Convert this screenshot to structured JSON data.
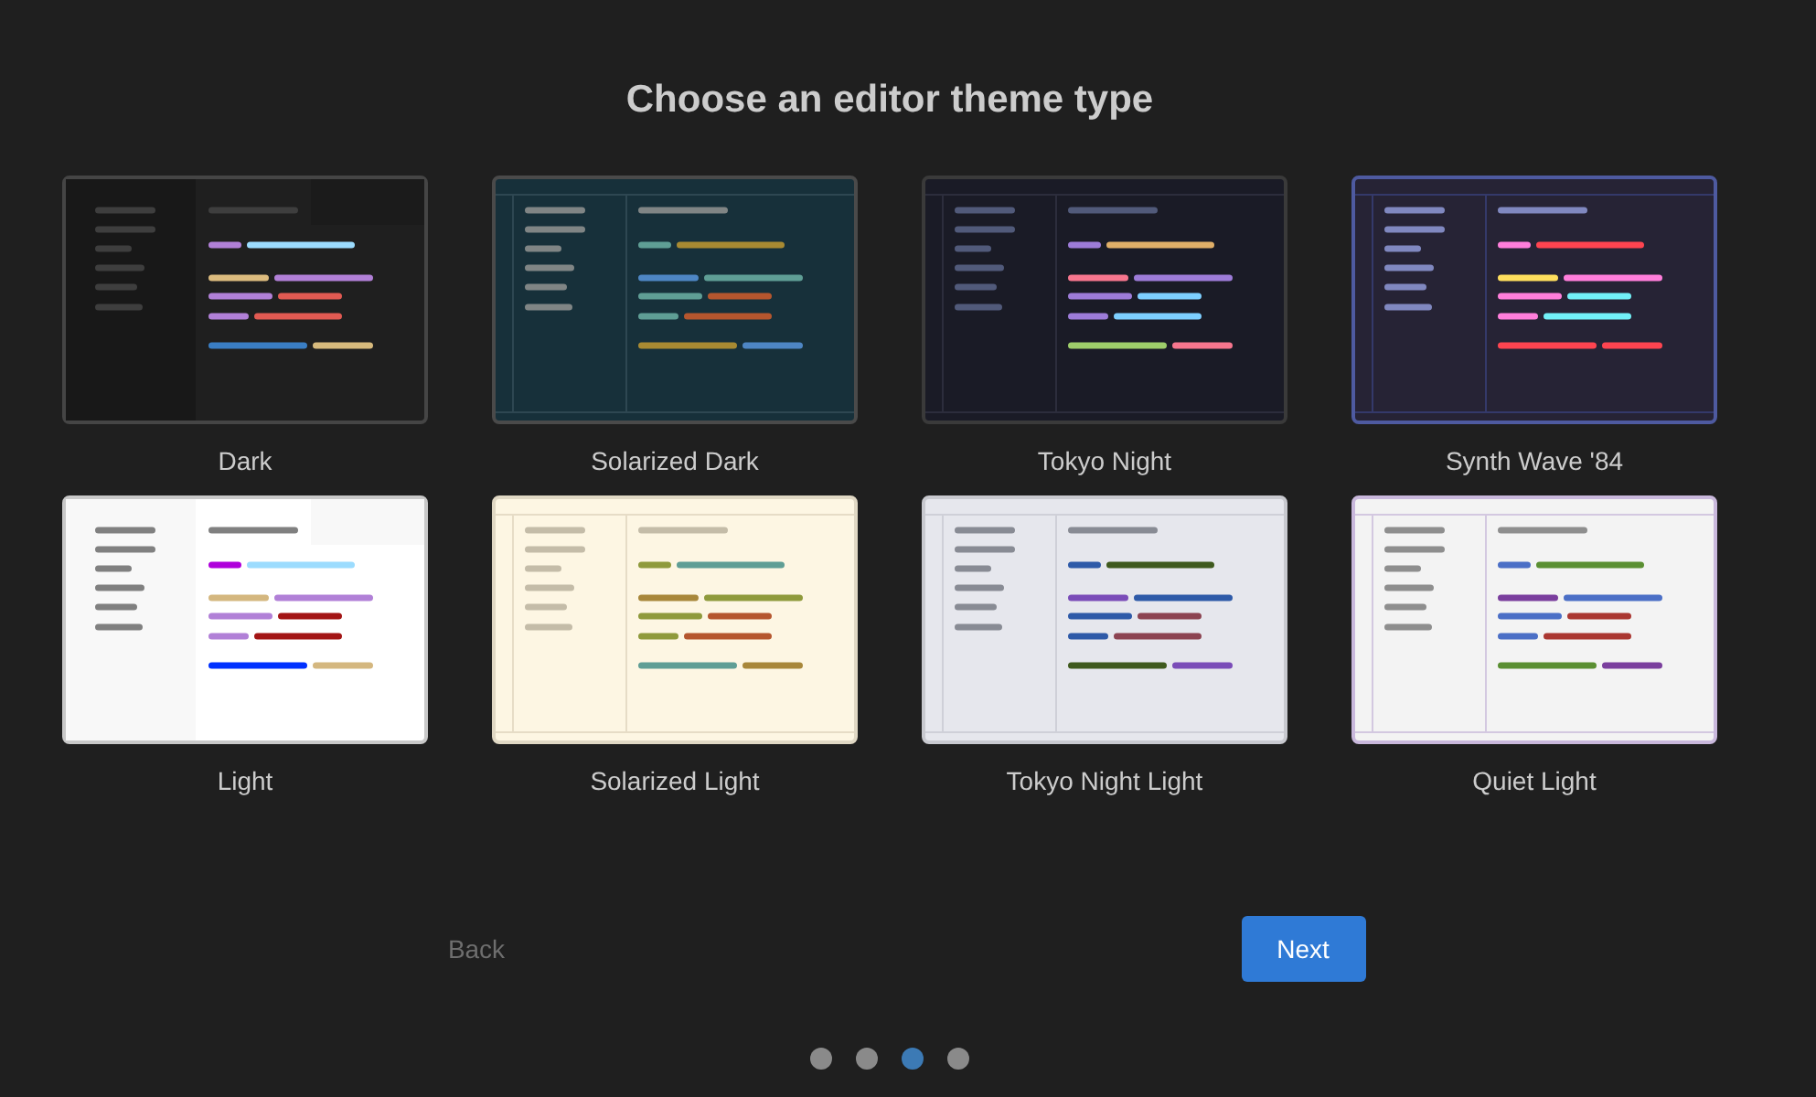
{
  "title": "Choose an editor theme type",
  "themes": [
    {
      "name": "Dark",
      "kind": "dark"
    },
    {
      "name": "Solarized Dark",
      "kind": "solarized-dark"
    },
    {
      "name": "Tokyo Night",
      "kind": "tokyo-night"
    },
    {
      "name": "Synth Wave '84",
      "kind": "synthwave"
    },
    {
      "name": "Light",
      "kind": "light"
    },
    {
      "name": "Solarized Light",
      "kind": "solarized-light"
    },
    {
      "name": "Tokyo Night Light",
      "kind": "tokyo-night-light"
    },
    {
      "name": "Quiet Light",
      "kind": "quiet-light"
    }
  ],
  "buttons": [
    {
      "label": "Back",
      "kind": "secondary",
      "disabled": true
    },
    {
      "label": "Next",
      "kind": "primary",
      "disabled": false
    }
  ],
  "pager": [
    {
      "selected": false
    },
    {
      "selected": false
    },
    {
      "selected": true
    },
    {
      "selected": false
    }
  ]
}
